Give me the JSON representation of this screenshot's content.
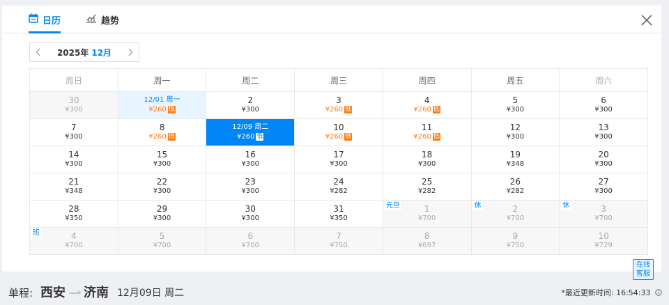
{
  "tabs": {
    "calendar": "日历",
    "trend": "趋势"
  },
  "month_nav": {
    "year": "2025年",
    "month": "12月"
  },
  "weekdays": [
    "周日",
    "周一",
    "周二",
    "周三",
    "周四",
    "周五",
    "周六"
  ],
  "weeks": [
    [
      {
        "d": "30",
        "p": "¥300",
        "other": true
      },
      {
        "d": "12/01 周一",
        "p": "¥260",
        "low": true,
        "hl": true
      },
      {
        "d": "2",
        "p": "¥300"
      },
      {
        "d": "3",
        "p": "¥260",
        "low": true
      },
      {
        "d": "4",
        "p": "¥260",
        "low": true
      },
      {
        "d": "5",
        "p": "¥300"
      },
      {
        "d": "6",
        "p": "¥300"
      }
    ],
    [
      {
        "d": "7",
        "p": "¥300"
      },
      {
        "d": "8",
        "p": "¥260",
        "low": true
      },
      {
        "d": "12/09 周二",
        "p": "¥260",
        "low": true,
        "sel": true
      },
      {
        "d": "10",
        "p": "¥260",
        "low": true
      },
      {
        "d": "11",
        "p": "¥260",
        "low": true
      },
      {
        "d": "12",
        "p": "¥300"
      },
      {
        "d": "13",
        "p": "¥300"
      }
    ],
    [
      {
        "d": "14",
        "p": "¥300"
      },
      {
        "d": "15",
        "p": "¥300"
      },
      {
        "d": "16",
        "p": "¥300"
      },
      {
        "d": "17",
        "p": "¥300"
      },
      {
        "d": "18",
        "p": "¥300"
      },
      {
        "d": "19",
        "p": "¥348"
      },
      {
        "d": "20",
        "p": "¥300"
      }
    ],
    [
      {
        "d": "21",
        "p": "¥348"
      },
      {
        "d": "22",
        "p": "¥300"
      },
      {
        "d": "23",
        "p": "¥300"
      },
      {
        "d": "24",
        "p": "¥282"
      },
      {
        "d": "25",
        "p": "¥282"
      },
      {
        "d": "26",
        "p": "¥282"
      },
      {
        "d": "27",
        "p": "¥300"
      }
    ],
    [
      {
        "d": "28",
        "p": "¥350"
      },
      {
        "d": "29",
        "p": "¥300"
      },
      {
        "d": "30",
        "p": "¥300"
      },
      {
        "d": "31",
        "p": "¥350"
      },
      {
        "d": "1",
        "p": "¥700",
        "other": true,
        "tag": "元旦"
      },
      {
        "d": "2",
        "p": "¥700",
        "other": true,
        "tag": "休"
      },
      {
        "d": "3",
        "p": "¥700",
        "other": true,
        "tag": "休"
      }
    ],
    [
      {
        "d": "4",
        "p": "¥700",
        "other": true,
        "tag": "班"
      },
      {
        "d": "5",
        "p": "¥700",
        "other": true
      },
      {
        "d": "6",
        "p": "¥700",
        "other": true
      },
      {
        "d": "7",
        "p": "¥750",
        "other": true
      },
      {
        "d": "8",
        "p": "¥697",
        "other": true
      },
      {
        "d": "9",
        "p": "¥750",
        "other": true
      },
      {
        "d": "10",
        "p": "¥729",
        "other": true
      }
    ]
  ],
  "low_label": "低",
  "service_button": "在线客服",
  "bottom": {
    "trip_label": "单程:",
    "from": "西安",
    "to": "济南",
    "date": "12月09日 周二",
    "update": "*最近更新时间: 16:54:33"
  },
  "colors": {
    "accent": "#0086f6",
    "low_price": "#ff7d13"
  }
}
